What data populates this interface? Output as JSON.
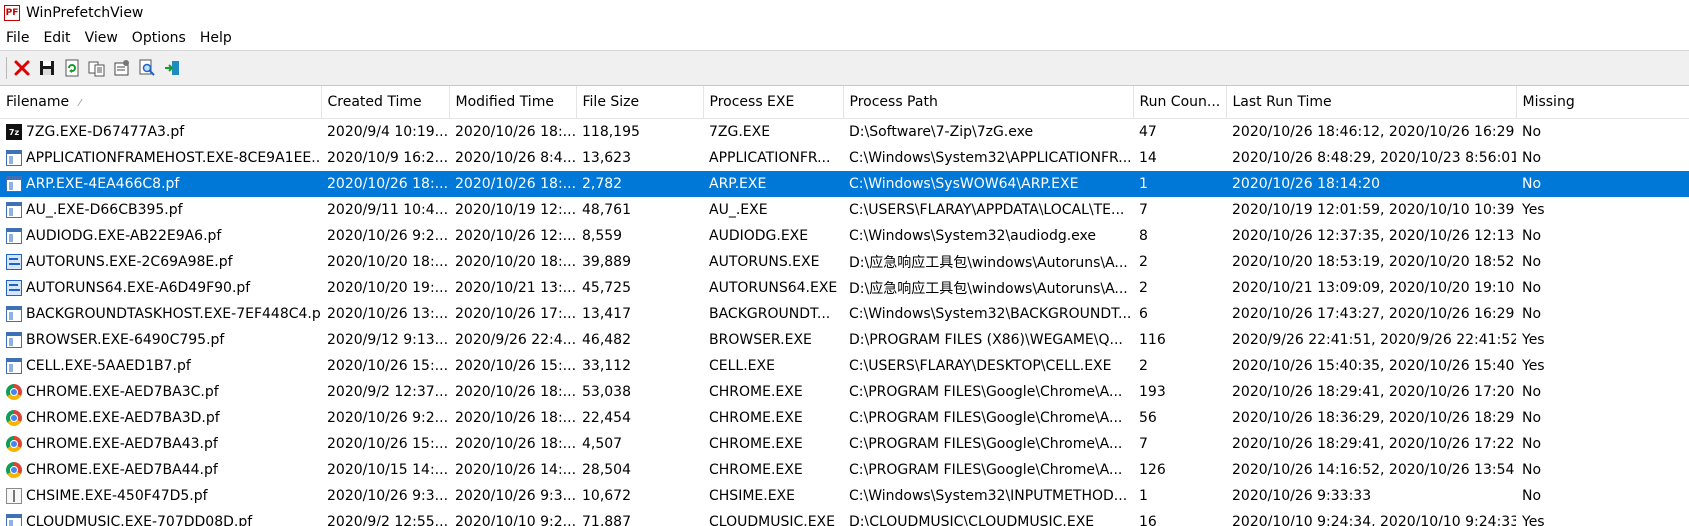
{
  "window": {
    "title": "WinPrefetchView",
    "app_icon_text": "PF"
  },
  "menu": [
    "File",
    "Edit",
    "View",
    "Options",
    "Help"
  ],
  "toolbar": {
    "buttons": [
      "delete-icon",
      "save-icon",
      "refresh-icon",
      "copy-icon",
      "properties-icon",
      "find-icon",
      "exit-icon"
    ]
  },
  "columns": [
    "Filename",
    "Created Time",
    "Modified Time",
    "File Size",
    "Process EXE",
    "Process Path",
    "Run Coun...",
    "Last Run Time",
    "Missing"
  ],
  "sort": {
    "column": "Filename",
    "glyph": "⁄"
  },
  "selected_color": "#0078d7",
  "rows": [
    {
      "icon": "zip",
      "filename": "7ZG.EXE-D67477A3.pf",
      "created": "2020/9/4 10:19...",
      "modified": "2020/10/26 18:...",
      "size": "118,195",
      "exe": "7ZG.EXE",
      "path": "D:\\Software\\7-Zip\\7zG.exe",
      "runs": "47",
      "last": "2020/10/26 18:46:12, 2020/10/26 16:29:...",
      "missing": "No"
    },
    {
      "icon": "window",
      "filename": "APPLICATIONFRAMEHOST.EXE-8CE9A1EE....",
      "created": "2020/10/9 16:2...",
      "modified": "2020/10/26 8:4...",
      "size": "13,623",
      "exe": "APPLICATIONFR...",
      "path": "C:\\Windows\\System32\\APPLICATIONFR...",
      "runs": "14",
      "last": "2020/10/26 8:48:29, 2020/10/23 8:56:01...",
      "missing": "No"
    },
    {
      "icon": "window",
      "filename": "ARP.EXE-4EA466C8.pf",
      "created": "2020/10/26 18:...",
      "modified": "2020/10/26 18:...",
      "size": "2,782",
      "exe": "ARP.EXE",
      "path": "C:\\Windows\\SysWOW64\\ARP.EXE",
      "runs": "1",
      "last": "2020/10/26 18:14:20",
      "missing": "No",
      "selected": true
    },
    {
      "icon": "window",
      "filename": "AU_.EXE-D66CB395.pf",
      "created": "2020/9/11 10:4...",
      "modified": "2020/10/19 12:...",
      "size": "48,761",
      "exe": "AU_.EXE",
      "path": "C:\\USERS\\FLARAY\\APPDATA\\LOCAL\\TE...",
      "runs": "7",
      "last": "2020/10/19 12:01:59, 2020/10/10 10:39:...",
      "missing": "Yes"
    },
    {
      "icon": "window",
      "filename": "AUDIODG.EXE-AB22E9A6.pf",
      "created": "2020/10/26 9:2...",
      "modified": "2020/10/26 12:...",
      "size": "8,559",
      "exe": "AUDIODG.EXE",
      "path": "C:\\Windows\\System32\\audiodg.exe",
      "runs": "8",
      "last": "2020/10/26 12:37:35, 2020/10/26 12:13:...",
      "missing": "No"
    },
    {
      "icon": "autoruns",
      "filename": "AUTORUNS.EXE-2C69A98E.pf",
      "created": "2020/10/20 18:...",
      "modified": "2020/10/20 18:...",
      "size": "39,889",
      "exe": "AUTORUNS.EXE",
      "path": "D:\\应急响应工具包\\windows\\Autoruns\\A...",
      "runs": "2",
      "last": "2020/10/20 18:53:19, 2020/10/20 18:52:...",
      "missing": "No"
    },
    {
      "icon": "autoruns",
      "filename": "AUTORUNS64.EXE-A6D49F90.pf",
      "created": "2020/10/20 19:...",
      "modified": "2020/10/21 13:...",
      "size": "45,725",
      "exe": "AUTORUNS64.EXE",
      "path": "D:\\应急响应工具包\\windows\\Autoruns\\A...",
      "runs": "2",
      "last": "2020/10/21 13:09:09, 2020/10/20 19:10:...",
      "missing": "No"
    },
    {
      "icon": "window",
      "filename": "BACKGROUNDTASKHOST.EXE-7EF448C4.pf",
      "created": "2020/10/26 13:...",
      "modified": "2020/10/26 17:...",
      "size": "13,417",
      "exe": "BACKGROUNDT...",
      "path": "C:\\Windows\\System32\\BACKGROUNDT...",
      "runs": "6",
      "last": "2020/10/26 17:43:27, 2020/10/26 16:29:...",
      "missing": "No"
    },
    {
      "icon": "window",
      "filename": "BROWSER.EXE-6490C795.pf",
      "created": "2020/9/12 9:13...",
      "modified": "2020/9/26 22:4...",
      "size": "46,482",
      "exe": "BROWSER.EXE",
      "path": "D:\\PROGRAM FILES (X86)\\WEGAME\\Q...",
      "runs": "116",
      "last": "2020/9/26 22:41:51, 2020/9/26 22:41:52...",
      "missing": "Yes"
    },
    {
      "icon": "window",
      "filename": "CELL.EXE-5AAED1B7.pf",
      "created": "2020/10/26 15:...",
      "modified": "2020/10/26 15:...",
      "size": "33,112",
      "exe": "CELL.EXE",
      "path": "C:\\USERS\\FLARAY\\DESKTOP\\CELL.EXE",
      "runs": "2",
      "last": "2020/10/26 15:40:35, 2020/10/26 15:40:...",
      "missing": "Yes"
    },
    {
      "icon": "chrome",
      "filename": "CHROME.EXE-AED7BA3C.pf",
      "created": "2020/9/2 12:37...",
      "modified": "2020/10/26 18:...",
      "size": "53,038",
      "exe": "CHROME.EXE",
      "path": "C:\\PROGRAM FILES\\Google\\Chrome\\A...",
      "runs": "193",
      "last": "2020/10/26 18:29:41, 2020/10/26 17:20:...",
      "missing": "No"
    },
    {
      "icon": "chrome",
      "filename": "CHROME.EXE-AED7BA3D.pf",
      "created": "2020/10/26 9:2...",
      "modified": "2020/10/26 18:...",
      "size": "22,454",
      "exe": "CHROME.EXE",
      "path": "C:\\PROGRAM FILES\\Google\\Chrome\\A...",
      "runs": "56",
      "last": "2020/10/26 18:36:29, 2020/10/26 18:29:...",
      "missing": "No"
    },
    {
      "icon": "chrome",
      "filename": "CHROME.EXE-AED7BA43.pf",
      "created": "2020/10/26 15:...",
      "modified": "2020/10/26 18:...",
      "size": "4,507",
      "exe": "CHROME.EXE",
      "path": "C:\\PROGRAM FILES\\Google\\Chrome\\A...",
      "runs": "7",
      "last": "2020/10/26 18:29:41, 2020/10/26 17:22:...",
      "missing": "No"
    },
    {
      "icon": "chrome",
      "filename": "CHROME.EXE-AED7BA44.pf",
      "created": "2020/10/15 14:...",
      "modified": "2020/10/26 14:...",
      "size": "28,504",
      "exe": "CHROME.EXE",
      "path": "C:\\PROGRAM FILES\\Google\\Chrome\\A...",
      "runs": "126",
      "last": "2020/10/26 14:16:52, 2020/10/26 13:54:...",
      "missing": "No"
    },
    {
      "icon": "ime",
      "filename": "CHSIME.EXE-450F47D5.pf",
      "created": "2020/10/26 9:3...",
      "modified": "2020/10/26 9:3...",
      "size": "10,672",
      "exe": "CHSIME.EXE",
      "path": "C:\\Windows\\System32\\INPUTMETHOD...",
      "runs": "1",
      "last": "2020/10/26 9:33:33",
      "missing": "No"
    },
    {
      "icon": "window",
      "filename": "CLOUDMUSIC.EXE-707DD08D.pf",
      "created": "2020/9/2 12:55...",
      "modified": "2020/10/10 9:2...",
      "size": "71,887",
      "exe": "CLOUDMUSIC.EXE",
      "path": "D:\\CLOUDMUSIC\\CLOUDMUSIC.EXE",
      "runs": "16",
      "last": "2020/10/10 9:24:34, 2020/10/10 9:24:33...",
      "missing": "Yes"
    }
  ]
}
